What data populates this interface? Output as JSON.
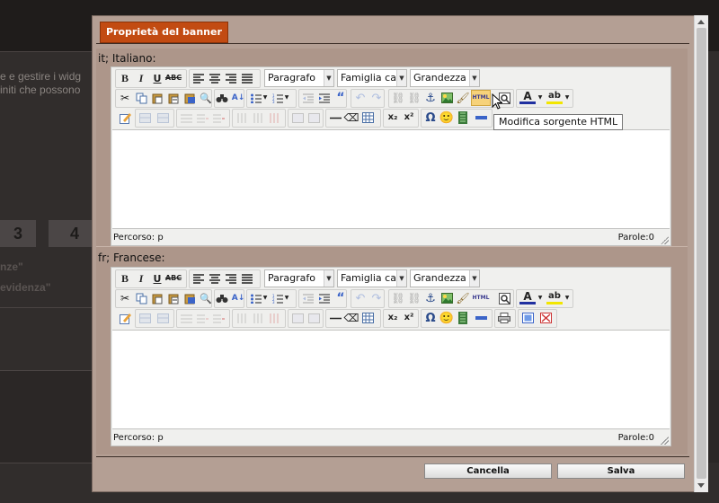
{
  "background": {
    "text_line1": "e e gestire i widg",
    "text_line2": "initi che possono",
    "num3": "3",
    "num4": "4",
    "frag1": "nze\"",
    "frag2": "evidenza\""
  },
  "dialog": {
    "tab_title": "Proprietà del banner",
    "cancel_label": "Cancella",
    "save_label": "Salva"
  },
  "editors": [
    {
      "language": "it; Italiano:",
      "format_select": "Paragrafo",
      "font_select": "Famiglia caratt",
      "size_select": "Grandezza cara",
      "status_path": "Percorso: p",
      "word_count": "Parole:0"
    },
    {
      "language": "fr; Francese:",
      "format_select": "Paragrafo",
      "font_select": "Famiglia caratt",
      "size_select": "Grandezza cara",
      "status_path": "Percorso: p",
      "word_count": "Parole:0"
    }
  ],
  "tooltip": "Modifica sorgente HTML",
  "icons": [
    "bold-icon",
    "italic-icon",
    "underline-icon",
    "strikethrough-icon",
    "align-left-icon",
    "align-center-icon",
    "align-right-icon",
    "justify-icon",
    "cut-icon",
    "copy-icon",
    "paste-icon",
    "paste-text-icon",
    "paste-word-icon",
    "find-icon",
    "replace-icon",
    "bullet-list-icon",
    "numbered-list-icon",
    "outdent-icon",
    "indent-icon",
    "blockquote-icon",
    "undo-icon",
    "redo-icon",
    "link-icon",
    "unlink-icon",
    "anchor-icon",
    "image-icon",
    "cleanup-icon",
    "html-source-icon",
    "preview-icon",
    "text-color-icon",
    "highlight-color-icon",
    "insert-layer-icon",
    "horizontal-rule-icon",
    "remove-format-icon",
    "table-icon",
    "subscript-icon",
    "superscript-icon",
    "special-char-icon",
    "emoticon-icon",
    "media-icon",
    "advanced-hr-icon",
    "print-icon",
    "fullscreen-icon",
    "visual-aid-icon"
  ]
}
